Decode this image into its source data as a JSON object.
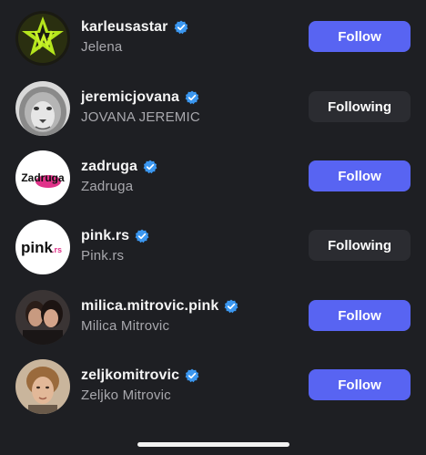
{
  "accounts": [
    {
      "username": "karleusastar",
      "full_name": "Jelena",
      "button": "Follow",
      "verified": true
    },
    {
      "username": "jeremicjovana",
      "full_name": "JOVANA JEREMIC",
      "button": "Following",
      "verified": true
    },
    {
      "username": "zadruga",
      "full_name": "Zadruga",
      "button": "Follow",
      "verified": true
    },
    {
      "username": "pink.rs",
      "full_name": "Pink.rs",
      "button": "Following",
      "verified": true
    },
    {
      "username": "milica.mitrovic.pink",
      "full_name": "Milica Mitrovic",
      "button": "Follow",
      "verified": true
    },
    {
      "username": "zeljkomitrovic",
      "full_name": "Zeljko Mitrovic",
      "button": "Follow",
      "verified": true
    }
  ],
  "avatar_text": {
    "zadruga_logo": "Zadruga",
    "pink_logo": "pink",
    "pink_logo_suffix": ".rs"
  },
  "colors": {
    "background": "#1e1f23",
    "follow_button": "#5864f2",
    "following_button": "#2b2c31",
    "verified_badge": "#3b97f0",
    "secondary_text": "#a8a8ad"
  },
  "icons": {
    "verified": "verified-badge-icon"
  }
}
